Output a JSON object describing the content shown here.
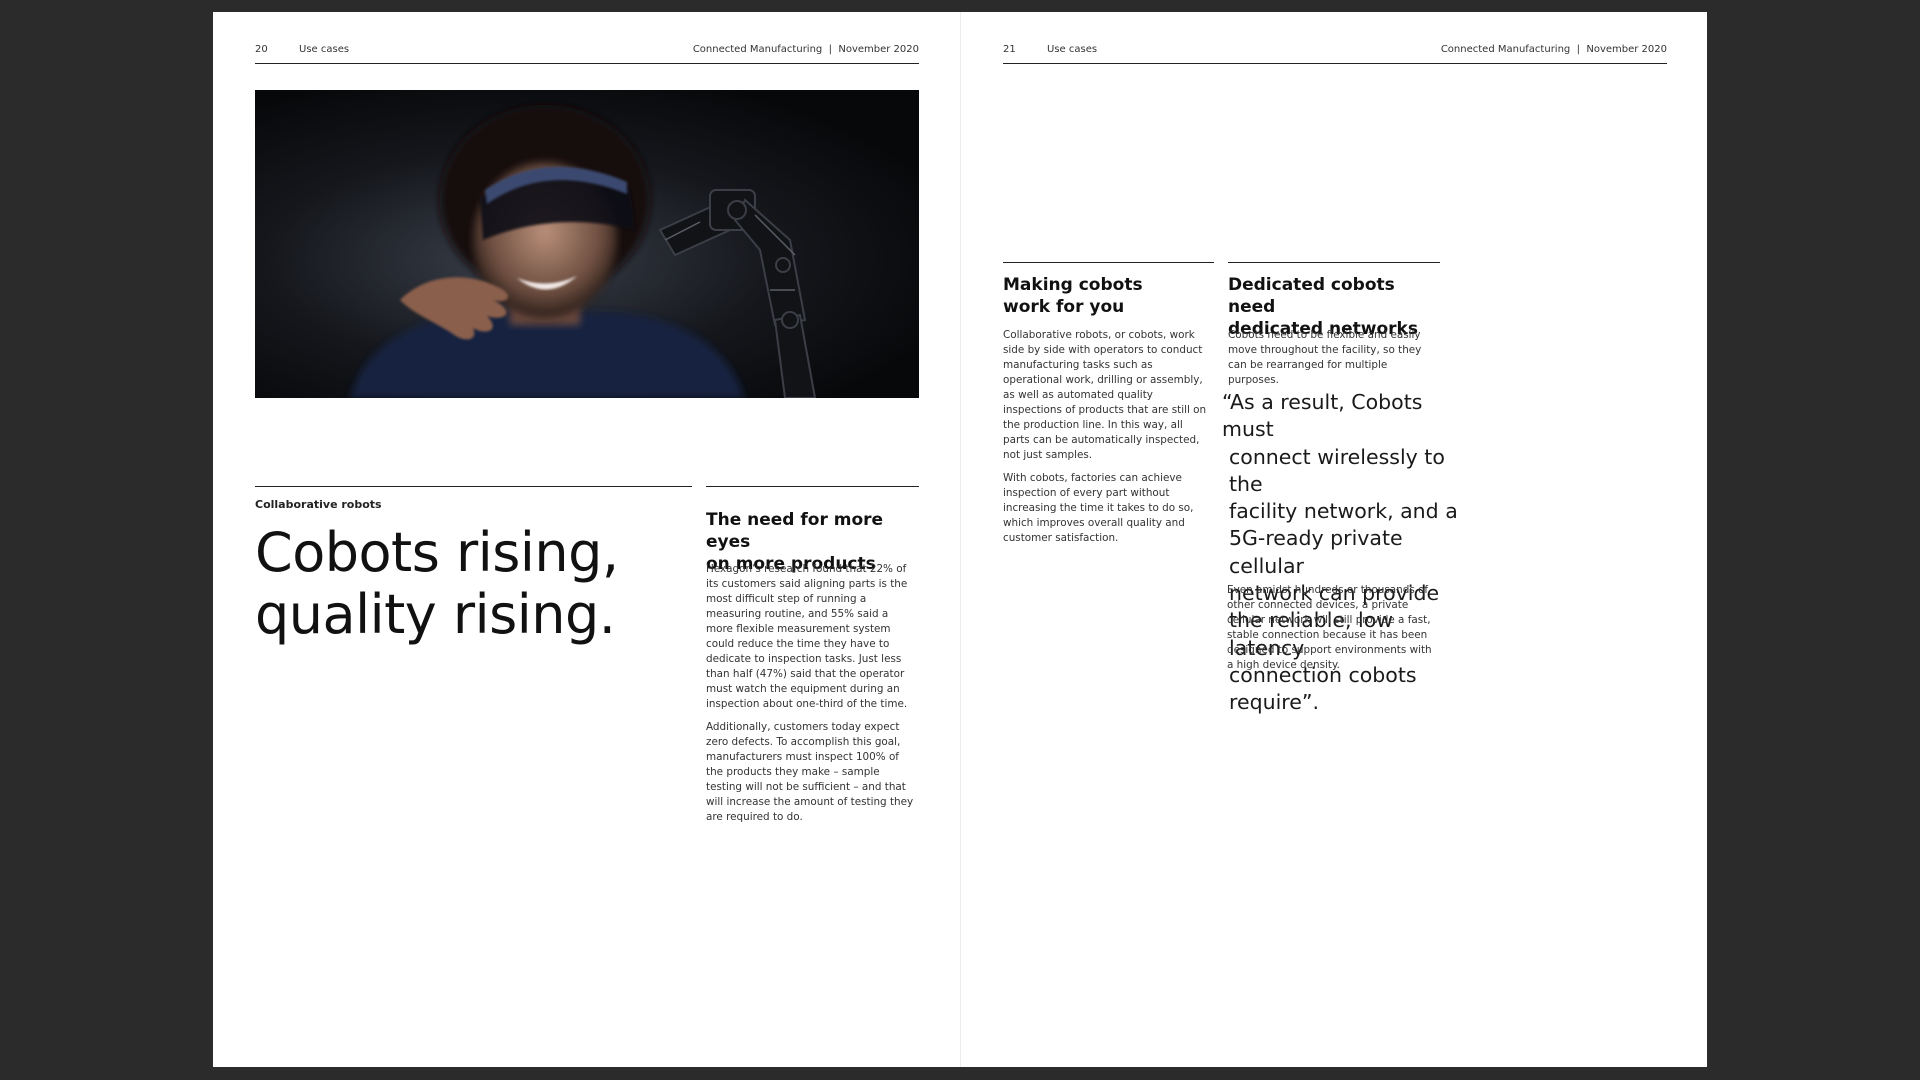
{
  "left_page": {
    "header": {
      "page_number": "20",
      "section": "Use cases",
      "publication": "Connected Manufacturing  |  November 2020"
    },
    "eyebrow": "Collaborative robots",
    "headline": [
      "Cobots rising,",
      "quality rising."
    ],
    "column": {
      "heading": [
        "The need for more eyes",
        "on more products"
      ],
      "paragraphs": [
        "Hexagon’s research found that 22% of its customers said aligning parts is the most difficult step of running a measuring routine, and 55% said a more flexible measurement system could reduce the time they have to dedicate to inspection tasks. Just less than half (47%) said that the operator must watch the equipment during an inspection about one-third of the time.",
        "Additionally, customers today expect zero defects. To accomplish this goal, manufacturers must inspect 100% of the products they make – sample testing will not be sufficient – and that will increase the amount of testing they are required to do."
      ]
    }
  },
  "right_page": {
    "header": {
      "page_number": "21",
      "section": "Use cases",
      "publication": "Connected Manufacturing  |  November 2020"
    },
    "col1": {
      "heading": [
        "Making cobots",
        "work for you"
      ],
      "paragraphs": [
        "Collaborative robots, or cobots, work side by side with operators to conduct manufacturing tasks such as operational work, drilling or assembly, as well as automated quality inspections of products that are still on the production line. In this way, all parts can be automatically inspected, not just samples.",
        "With cobots, factories can achieve inspection of every part without increasing the time it takes to do so, which improves overall quality and customer satisfaction."
      ]
    },
    "col2": {
      "heading": [
        "Dedicated cobots need",
        "dedicated networks"
      ],
      "intro": "Cobots need to be flexible and easily move throughout the facility, so they can be rearranged for multiple purposes.",
      "quote": [
        "“As a result, Cobots must",
        "connect wirelessly to the",
        "facility network, and a",
        "5G-ready private cellular",
        "network can provide",
        "the reliable, low latency",
        "connection cobots require”."
      ],
      "closing": "Even amidst hundreds or thousands of other connected devices, a private cellular network will still provide a fast, stable connection because it has been designed to support environments with a high device density."
    }
  }
}
